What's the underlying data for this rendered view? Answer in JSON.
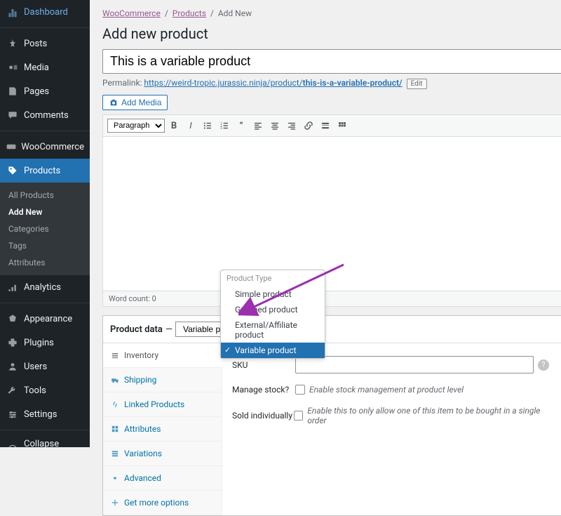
{
  "sidebar": {
    "items": [
      {
        "label": "Dashboard",
        "icon": "dashboard"
      },
      {
        "label": "Posts",
        "icon": "pin"
      },
      {
        "label": "Media",
        "icon": "media"
      },
      {
        "label": "Pages",
        "icon": "pages"
      },
      {
        "label": "Comments",
        "icon": "comments"
      },
      {
        "label": "WooCommerce",
        "icon": "woo"
      },
      {
        "label": "Products",
        "icon": "products",
        "current": true
      },
      {
        "label": "Analytics",
        "icon": "analytics"
      },
      {
        "label": "Appearance",
        "icon": "appearance"
      },
      {
        "label": "Plugins",
        "icon": "plugins"
      },
      {
        "label": "Users",
        "icon": "users"
      },
      {
        "label": "Tools",
        "icon": "tools"
      },
      {
        "label": "Settings",
        "icon": "settings"
      },
      {
        "label": "Collapse menu",
        "icon": "collapse"
      }
    ],
    "submenu": [
      {
        "label": "All Products"
      },
      {
        "label": "Add New",
        "current": true
      },
      {
        "label": "Categories"
      },
      {
        "label": "Tags"
      },
      {
        "label": "Attributes"
      }
    ]
  },
  "breadcrumb": {
    "a": "WooCommerce",
    "b": "Products",
    "c": "Add New"
  },
  "page": {
    "title": "Add new product",
    "product_title": "This is a variable product",
    "permalink_label": "Permalink:",
    "permalink_base": "https://weird-tropic.jurassic.ninja/product/",
    "permalink_slug": "this-is-a-variable-product/",
    "edit_label": "Edit",
    "add_media_label": "Add Media",
    "format_select": "Paragraph",
    "word_count_label": "Word count:",
    "word_count_value": "0"
  },
  "product_data": {
    "header_label": "Product data",
    "dropdown_header": "Product Type",
    "options": [
      {
        "label": "Simple product"
      },
      {
        "label": "Grouped product"
      },
      {
        "label": "External/Affiliate product"
      },
      {
        "label": "Variable product",
        "selected": true
      }
    ],
    "tabs": [
      {
        "label": "Inventory",
        "icon": "inventory",
        "active": true
      },
      {
        "label": "Shipping",
        "icon": "shipping"
      },
      {
        "label": "Linked Products",
        "icon": "linked"
      },
      {
        "label": "Attributes",
        "icon": "attributes"
      },
      {
        "label": "Variations",
        "icon": "variations"
      },
      {
        "label": "Advanced",
        "icon": "advanced"
      },
      {
        "label": "Get more options",
        "icon": "more"
      }
    ],
    "panel": {
      "sku_label": "SKU",
      "sku_value": "",
      "manage_stock_label": "Manage stock?",
      "manage_stock_desc": "Enable stock management at product level",
      "sold_individually_label": "Sold individually",
      "sold_individually_desc": "Enable this to only allow one of this item to be bought in a single order"
    }
  }
}
